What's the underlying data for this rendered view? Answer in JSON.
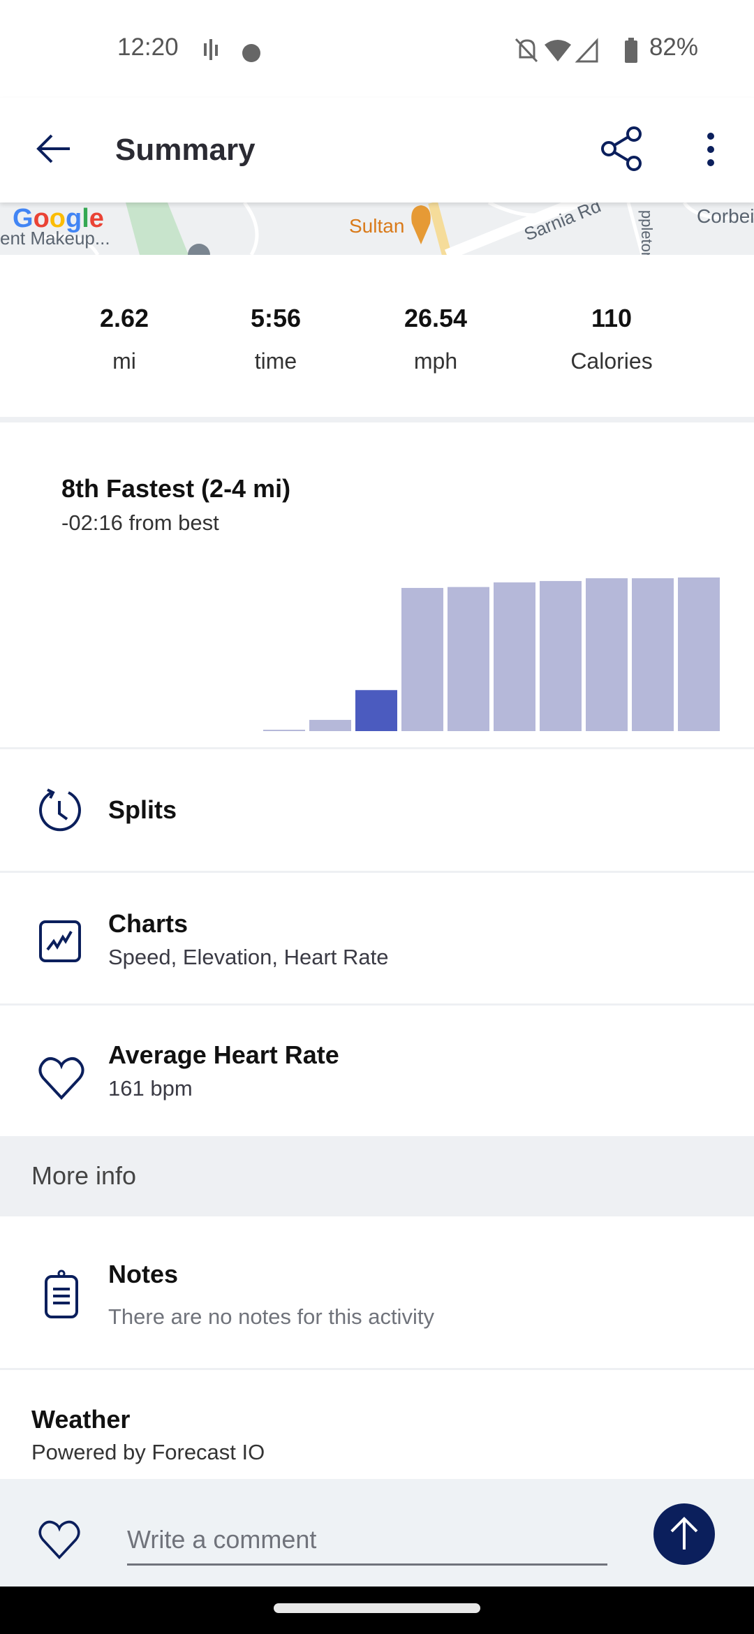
{
  "status_bar": {
    "time": "12:20",
    "battery": "82%"
  },
  "app_bar": {
    "title": "Summary",
    "back_icon": "arrow-left-icon",
    "share_icon": "share-icon",
    "menu_icon": "more-vert-icon"
  },
  "map": {
    "labels": [
      "ent Makeup...",
      "Sultan",
      "Sarnia Rd",
      "ppleton",
      "Corbei"
    ],
    "logo": "Google"
  },
  "stats": [
    {
      "value": "2.62",
      "label": "mi"
    },
    {
      "value": "5:56",
      "label": "time"
    },
    {
      "value": "26.54",
      "label": "mph"
    },
    {
      "value": "110",
      "label": "Calories"
    }
  ],
  "ranking": {
    "title": "8th Fastest (2-4 mi)",
    "subtitle": "-02:16 from best"
  },
  "chart_data": {
    "type": "bar",
    "values": [
      0.3,
      7.3,
      26.7,
      93.2,
      93.8,
      96.8,
      97.7,
      99.5,
      99.5,
      100
    ],
    "highlight_index": 2,
    "ylim": [
      0,
      100
    ],
    "colors": {
      "bar": "#b5b8d9",
      "highlight": "#4b5bbf"
    }
  },
  "rows": {
    "splits": {
      "title": "Splits",
      "icon": "timer-icon"
    },
    "charts": {
      "title": "Charts",
      "subtitle": "Speed, Elevation, Heart Rate",
      "icon": "line-chart-icon"
    },
    "heart_rate": {
      "title": "Average Heart Rate",
      "subtitle": "161 bpm",
      "icon": "heart-icon"
    }
  },
  "more_info": {
    "label": "More info"
  },
  "notes": {
    "title": "Notes",
    "subtitle": "There are no notes for this activity",
    "icon": "clipboard-icon"
  },
  "weather": {
    "title": "Weather",
    "subtitle": "Powered by Forecast IO"
  },
  "comment": {
    "placeholder": "Write a comment"
  },
  "colors": {
    "accent": "#0b1f5c",
    "divider": "#eef0f3"
  }
}
